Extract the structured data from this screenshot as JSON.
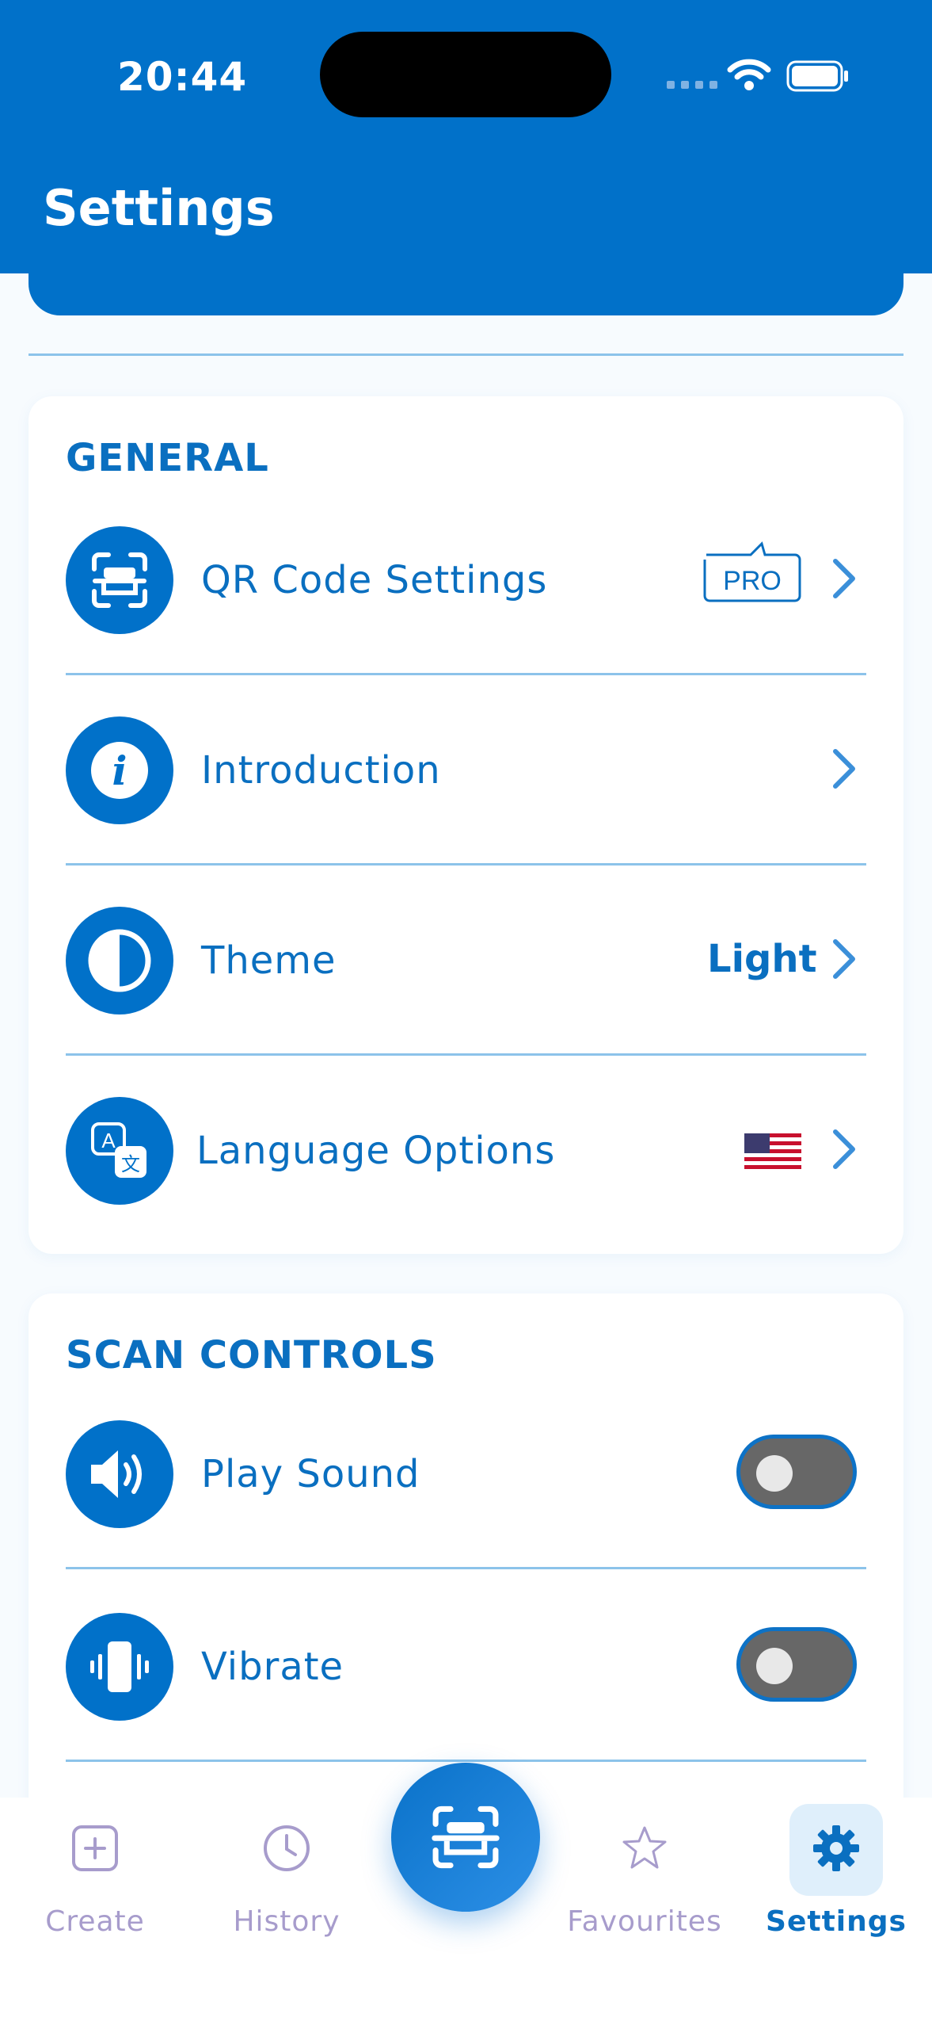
{
  "status_bar": {
    "time": "20:44"
  },
  "header": {
    "title": "Settings"
  },
  "general": {
    "section_title": "GENERAL",
    "items": [
      {
        "label": "QR Code Settings",
        "badge": "PRO",
        "icon": "qr-scan-icon"
      },
      {
        "label": "Introduction",
        "icon": "info-icon"
      },
      {
        "label": "Theme",
        "value": "Light",
        "icon": "contrast-icon"
      },
      {
        "label": "Language Options",
        "value_icon": "us-flag",
        "icon": "translate-icon"
      }
    ]
  },
  "scan_controls": {
    "section_title": "SCAN CONTROLS",
    "items": [
      {
        "label": "Play Sound",
        "toggle_on": false,
        "icon": "speaker-icon"
      },
      {
        "label": "Vibrate",
        "toggle_on": false,
        "icon": "vibrate-icon"
      }
    ]
  },
  "tab_bar": {
    "tabs": [
      {
        "label": "Create",
        "icon": "plus-square-icon",
        "active": false
      },
      {
        "label": "History",
        "icon": "clock-icon",
        "active": false
      },
      {
        "label": "Favourites",
        "icon": "star-icon",
        "active": false
      },
      {
        "label": "Settings",
        "icon": "gear-icon",
        "active": true
      }
    ],
    "center_button_icon": "qr-scan-icon"
  },
  "colors": {
    "primary": "#0171c9",
    "text_primary": "#0a6fc0",
    "divider": "#8cc3ea",
    "inactive_tab": "#a79ccc",
    "toggle_off": "#676767"
  }
}
